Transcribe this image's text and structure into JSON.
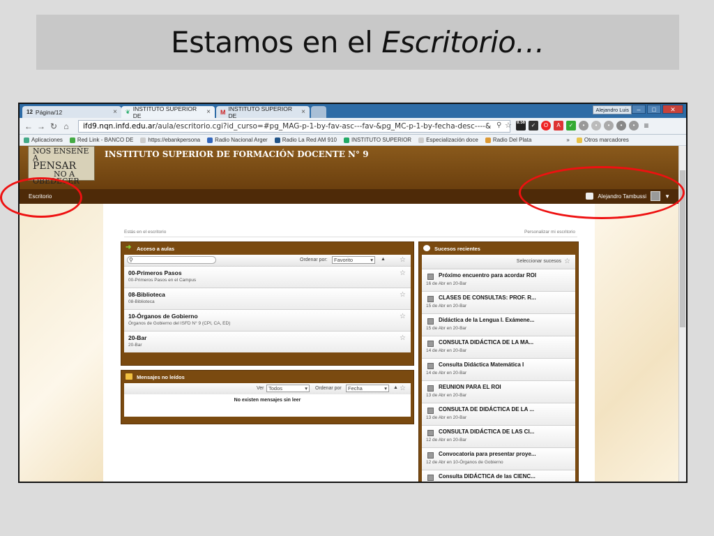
{
  "slide": {
    "title_prefix": "Estamos en el ",
    "title_italic": "Escritorio…"
  },
  "browser": {
    "tabs": [
      {
        "label": "Página/12",
        "badge": "12"
      },
      {
        "label": "INSTITUTO SUPERIOR DE"
      },
      {
        "label": "INSTITUTO SUPERIOR DE"
      }
    ],
    "profile_name": "Alejandro Luis",
    "url_domain": "ifd9.nqn.infd.edu.ar",
    "url_path": "/aula/escritorio.cgi?id_curso=#pg_MAG-p-1-by-fav-asc---fav-&pg_MC-p-1-by-fecha-desc----&",
    "ext_time": "8:56",
    "bookmarks": [
      "Aplicaciones",
      "Red Link - BANCO DE",
      "https://ebankpersona",
      "Radio Nacional Arger",
      "Radio La Red AM 910",
      "INSTITUTO SUPERIOR",
      "Especialización doce",
      "Radio Del Plata"
    ],
    "bookmarks_overflow": "»",
    "other_bookmarks": "Otros marcadores"
  },
  "site": {
    "logo_lines": [
      "NOS ENSEÑE A",
      "PENSAR",
      "NO A",
      "OBEDECER"
    ],
    "school_name": "INSTITUTO SUPERIOR DE FORMACIÓN DOCENTE N° 9",
    "nav_escritorio": "Escritorio",
    "user_name": "Alejandro Tambussi",
    "breadcrumb": "Estás en el escritorio",
    "personalize": "Personalizar mi escritorio"
  },
  "acceso": {
    "title": "Acceso a aulas",
    "order_label": "Ordenar por:",
    "order_value": "Favorito",
    "courses": [
      {
        "title": "00-Primeros Pasos",
        "subtitle": "00-Primeros Pasos en el Campus"
      },
      {
        "title": "08-Biblioteca",
        "subtitle": "08-Biblioteca"
      },
      {
        "title": "10-Órganos de Gobierno",
        "subtitle": "Órganos de Gobierno del ISFD N° 9 (CPI, CA, ED)"
      },
      {
        "title": "20-Bar",
        "subtitle": "20-Bar"
      }
    ]
  },
  "mensajes": {
    "title": "Mensajes no leídos",
    "ver_label": "Ver",
    "ver_value": "Todos",
    "order_label": "Ordenar por",
    "order_value": "Fecha",
    "empty": "No existen mensajes sin leer"
  },
  "sucesos": {
    "title": "Sucesos recientes",
    "select_label": "Seleccionar sucesos",
    "events": [
      {
        "title": "Próximo encuentro para acordar ROI",
        "meta": "16 de Abr en 20-Bar"
      },
      {
        "title": "CLASES DE CONSULTAS: PROF. R...",
        "meta": "15 de Abr en 20-Bar"
      },
      {
        "title": "Didáctica de la Lengua I. Exámene...",
        "meta": "15 de Abr en 20-Bar"
      },
      {
        "title": "CONSULTA DIDÁCTICA DE LA MA...",
        "meta": "14 de Abr en 20-Bar"
      },
      {
        "title": "Consulta Didáctica Matemática I",
        "meta": "14 de Abr en 20-Bar"
      },
      {
        "title": "REUNION PARA EL ROI",
        "meta": "13 de Abr en 20-Bar"
      },
      {
        "title": "CONSULTA DE DIDÁCTICA DE LA ...",
        "meta": "13 de Abr en 20-Bar"
      },
      {
        "title": "CONSULTA DIDÁCTICA DE LAS CI...",
        "meta": "12 de Abr en 20-Bar"
      },
      {
        "title": "Convocatoria para presentar proye...",
        "meta": "12 de Abr en 10-Órganos de Gobierno"
      },
      {
        "title": "Consulta DIDÁCTICA de las CIENC...",
        "meta": ""
      }
    ]
  }
}
